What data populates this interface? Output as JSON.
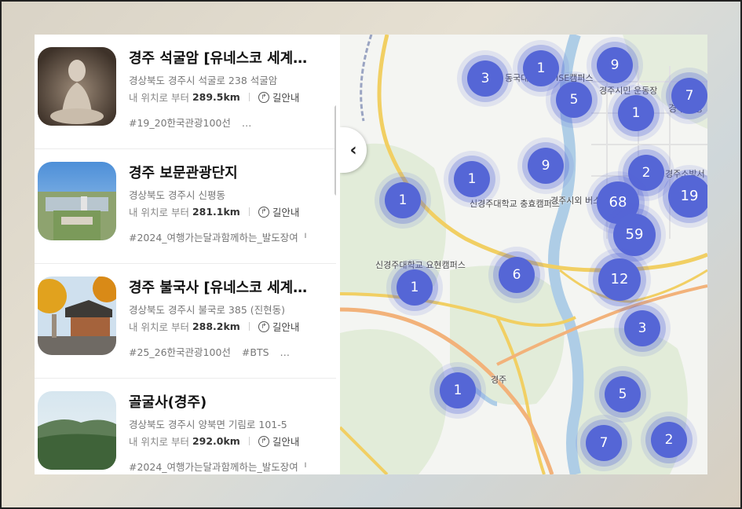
{
  "places": [
    {
      "title": "경주 석굴암 [유네스코 세계…",
      "address": "경상북도 경주시 석굴로 238 석굴암",
      "distance_prefix": "내 위치로 부터",
      "distance": "289.5km",
      "directions": "길안내",
      "tags": [
        "#19_20한국관광100선",
        "…"
      ]
    },
    {
      "title": "경주 보문관광단지",
      "address": "경상북도 경주시 신평동",
      "distance_prefix": "내 위치로 부터",
      "distance": "281.1km",
      "directions": "길안내",
      "tags": [
        "#2024_여행가는달과함께하는_발도장여ᅵ"
      ]
    },
    {
      "title": "경주 불국사 [유네스코 세계…",
      "address": "경상북도 경주시 불국로 385 (진현동)",
      "distance_prefix": "내 위치로 부터",
      "distance": "288.2km",
      "directions": "길안내",
      "tags": [
        "#25_26한국관광100선",
        "#BTS",
        "…"
      ]
    },
    {
      "title": "골굴사(경주)",
      "address": "경상북도 경주시 양북면 기림로 101-5",
      "distance_prefix": "내 위치로 부터",
      "distance": "292.0km",
      "directions": "길안내",
      "tags": [
        "#2024_여행가는달과함께하는_발도장여ᅵ"
      ]
    }
  ],
  "map": {
    "collapse_icon": "chevron-left-icon",
    "clusters": [
      "3",
      "1",
      "9",
      "5",
      "1",
      "7",
      "9",
      "1",
      "2",
      "19",
      "1",
      "68",
      "59",
      "1",
      "6",
      "12",
      "3",
      "1",
      "5",
      "7",
      "2"
    ],
    "labels": [
      "동국대학교 WISE캠퍼스",
      "경주시민 운동장",
      "경주시청",
      "신경주대학교 충효캠퍼스",
      "경주시외 버스터미널",
      "신경주대학교 요현캠퍼스",
      "경주",
      "경주소방서"
    ]
  }
}
